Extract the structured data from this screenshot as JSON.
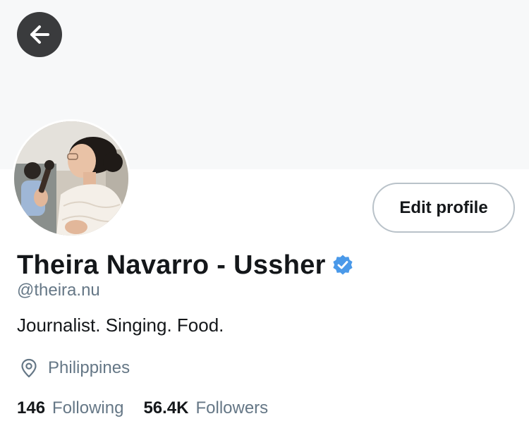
{
  "header": {
    "back_icon": "arrow-left-icon"
  },
  "profile": {
    "avatar_icon": "profile-photo",
    "edit_button_label": "Edit profile",
    "display_name": "Theira Navarro - Ussher",
    "verified_icon": "verified-badge-icon",
    "verified_color": "#4a99e9",
    "handle": "@theira.nu",
    "bio": "Journalist. Singing. Food.",
    "location_icon": "location-pin-icon",
    "location": "Philippines"
  },
  "stats": {
    "following_count": "146",
    "following_label": "Following",
    "followers_count": "56.4K",
    "followers_label": "Followers"
  }
}
